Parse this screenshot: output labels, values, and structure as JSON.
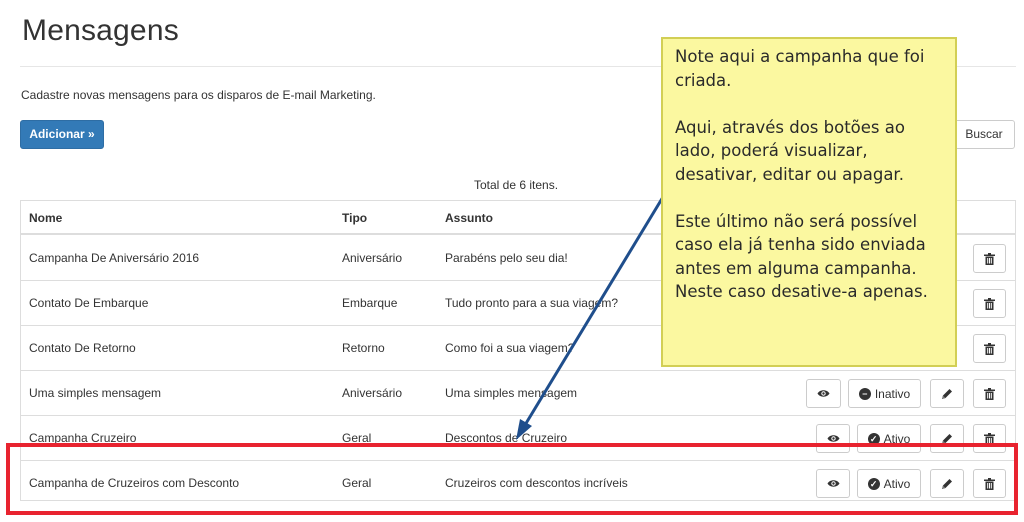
{
  "page": {
    "title": "Mensagens",
    "subtitle": "Cadastre novas mensagens para os disparos de E-mail Marketing."
  },
  "toolbar": {
    "add_label": "Adicionar »",
    "search_label": "Buscar"
  },
  "table": {
    "total": "Total de 6 itens.",
    "columns": [
      "Nome",
      "Tipo",
      "Assunto"
    ],
    "rows": [
      {
        "nome": "Campanha De Aniversário 2016",
        "tipo": "Aniversário",
        "assunto": "Parabéns pelo seu dia!"
      },
      {
        "nome": "Contato De Embarque",
        "tipo": "Embarque",
        "assunto": "Tudo pronto para a sua viagem?"
      },
      {
        "nome": "Contato De Retorno",
        "tipo": "Retorno",
        "assunto": "Como foi a sua viagem?"
      },
      {
        "nome": "Uma simples mensagem",
        "tipo": "Aniversário",
        "assunto": "Uma simples mensagem",
        "status": "Inativo"
      },
      {
        "nome": "Campanha Cruzeiro",
        "tipo": "Geral",
        "assunto": "Descontos de Cruzeiro",
        "status": "Ativo"
      },
      {
        "nome": "Campanha de Cruzeiros com Desconto",
        "tipo": "Geral",
        "assunto": "Cruzeiros com descontos incríveis",
        "status": "Ativo"
      }
    ]
  },
  "actions": {
    "icons": [
      "eye-icon",
      "minus-circle-icon",
      "check-circle-icon",
      "pencil-icon",
      "trash-icon"
    ]
  },
  "note": {
    "lines": [
      "Note aqui a campanha que foi criada.",
      "Aqui, através dos botões ao lado, poderá visualizar, desativar, editar ou apagar.",
      "Este último não será possível caso ela já tenha sido enviada antes em alguma campanha. Neste caso desative-a apenas."
    ],
    "background": "#fbf8a0"
  },
  "colors": {
    "primary": "#337ab7",
    "highlight": "#e8232f",
    "arrow": "#1f4e8c"
  }
}
